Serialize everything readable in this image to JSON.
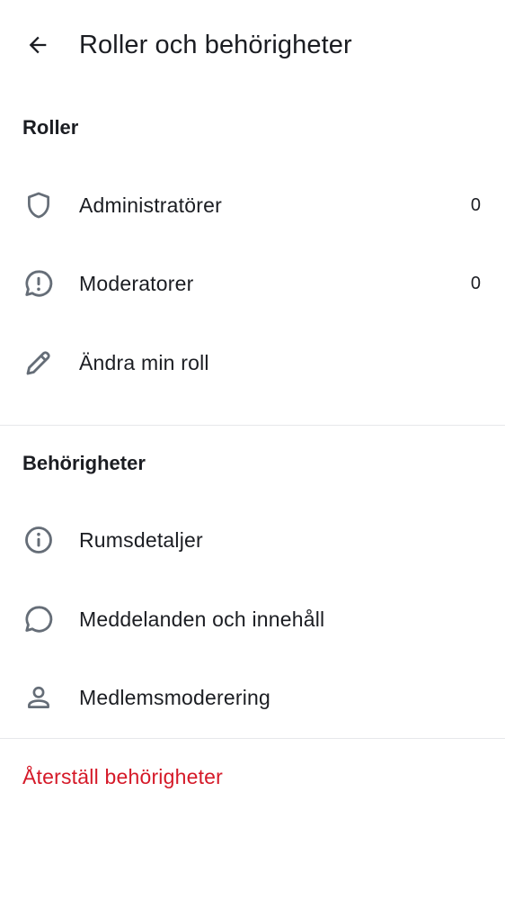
{
  "header": {
    "title": "Roller och behörigheter",
    "back_icon": "arrow-left-icon"
  },
  "roles_section": {
    "title": "Roller",
    "items": [
      {
        "label": "Administratörer",
        "count": "0",
        "icon": "shield-icon"
      },
      {
        "label": "Moderatorer",
        "count": "0",
        "icon": "chat-alert-icon"
      },
      {
        "label": "Ändra min roll",
        "icon": "pencil-icon"
      }
    ]
  },
  "permissions_section": {
    "title": "Behörigheter",
    "items": [
      {
        "label": "Rumsdetaljer",
        "icon": "info-icon"
      },
      {
        "label": "Meddelanden och innehåll",
        "icon": "chat-bubble-icon"
      },
      {
        "label": "Medlemsmoderering",
        "icon": "user-icon"
      }
    ]
  },
  "reset": {
    "label": "Återställ behörigheter",
    "color": "#d51928"
  },
  "colors": {
    "text": "#1b1d22",
    "icon": "#656d77",
    "divider": "#e6e8eb",
    "background": "#ffffff"
  }
}
